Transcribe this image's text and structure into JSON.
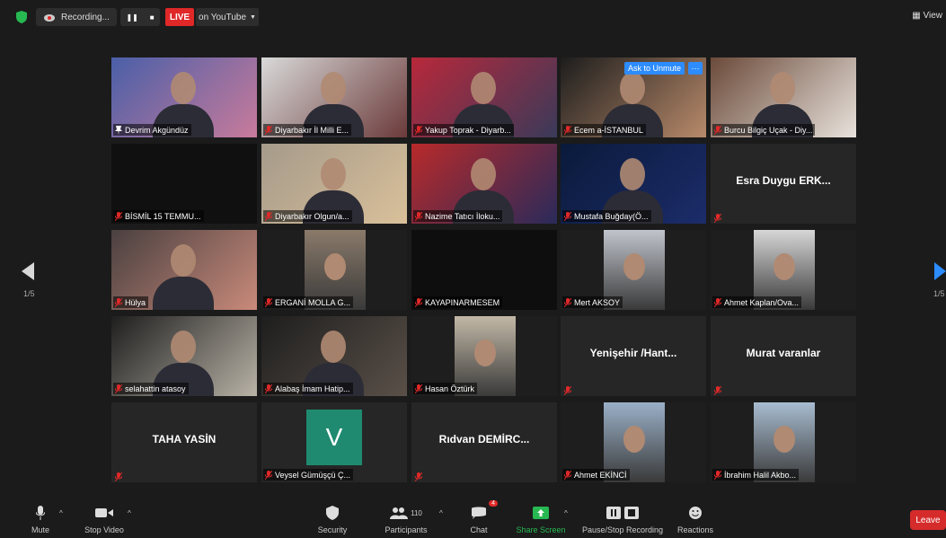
{
  "topbar": {
    "recording_label": "Recording...",
    "live_label": "LIVE",
    "stream_label": "on YouTube",
    "view_label": "View"
  },
  "unmute_label": "Ask to Unmute",
  "more_label": "···",
  "pagination": {
    "left": "1/5",
    "right": "1/5"
  },
  "tiles": [
    {
      "name": "Devrim Akgündüz",
      "type": "video",
      "colors": [
        "#4a5fa8",
        "#c97b9b"
      ]
    },
    {
      "name": "Diyarbakır İl Milli E...",
      "type": "video",
      "colors": [
        "#d9d9d9",
        "#6b3a3a"
      ]
    },
    {
      "name": "Yakup Toprak - Diyarb...",
      "type": "video",
      "colors": [
        "#b8283a",
        "#3a3a5a"
      ]
    },
    {
      "name": "Ecem a-İSTANBUL",
      "type": "video",
      "colors": [
        "#1d1d1d",
        "#b88a6a"
      ]
    },
    {
      "name": "Burcu Bilgiç Uçak - Diy...",
      "type": "video",
      "colors": [
        "#6b4a3a",
        "#e8e2dc"
      ]
    },
    {
      "name": "BİSMİL 15 TEMMU...",
      "type": "blank",
      "colors": [
        "#101010",
        "#101010"
      ]
    },
    {
      "name": "Diyarbakır Olgun/a...",
      "type": "video",
      "colors": [
        "#a59a8a",
        "#d9c09a"
      ]
    },
    {
      "name": "Nazime Tatıcı İloku...",
      "type": "video",
      "colors": [
        "#b82a2a",
        "#2a2a5a"
      ]
    },
    {
      "name": "Mustafa Buğday(Ö...",
      "type": "video",
      "colors": [
        "#0a1a3a",
        "#1c2c6a"
      ]
    },
    {
      "name": "Esra Duygu ERK...",
      "type": "name"
    },
    {
      "name": "Hülya",
      "type": "video",
      "colors": [
        "#4a4040",
        "#c98a7a"
      ]
    },
    {
      "name": "ERGANİ MOLLA G...",
      "type": "video",
      "colors": [
        "#1e1e1e",
        "#8a7a6a"
      ]
    },
    {
      "name": "KAYAPINARMESEM",
      "type": "blank",
      "colors": [
        "#0e0e0e",
        "#0e0e0e"
      ]
    },
    {
      "name": "Mert AKSOY",
      "type": "video",
      "colors": [
        "#1e1e1e",
        "#c0c4cc"
      ]
    },
    {
      "name": "Ahmet Kaplan/Ova...",
      "type": "video",
      "colors": [
        "#1e1e1e",
        "#d6d6d6"
      ]
    },
    {
      "name": "selahattin atasoy",
      "type": "video",
      "colors": [
        "#1e1e1e",
        "#b8b2a6"
      ]
    },
    {
      "name": "Alabaş İmam Hatip...",
      "type": "video",
      "colors": [
        "#1e1e1e",
        "#5a5048"
      ]
    },
    {
      "name": "Hasan Öztürk",
      "type": "video",
      "colors": [
        "#1e1e1e",
        "#c2b8a6"
      ]
    },
    {
      "name": "Yenişehir /Hant...",
      "type": "name"
    },
    {
      "name": "Murat varanlar",
      "type": "name"
    },
    {
      "name": "TAHA YASİN",
      "type": "name"
    },
    {
      "name": "Veysel Gümüşçü Ç...",
      "type": "avatar",
      "letter": "V",
      "avatar_color": "#1f8a70"
    },
    {
      "name": "Rıdvan DEMİRC...",
      "type": "name"
    },
    {
      "name": "Ahmet EKİNCİ",
      "type": "video",
      "colors": [
        "#1e1e1e",
        "#9ab0c8"
      ]
    },
    {
      "name": "İbrahim Halil Akbo...",
      "type": "video",
      "colors": [
        "#1e1e1e",
        "#a8bcd0"
      ]
    }
  ],
  "toolbar": {
    "mute": "Mute",
    "stop_video": "Stop Video",
    "security": "Security",
    "participants": "Participants",
    "participants_count": "110",
    "chat": "Chat",
    "chat_badge": "4",
    "share_screen": "Share Screen",
    "pause_recording": "Pause/Stop Recording",
    "reactions": "Reactions",
    "leave": "Leave"
  },
  "colors": {
    "accent_green": "#27b852",
    "live_red": "#e02828",
    "unmute_blue": "#2d8cff",
    "active_outline": "#c8d83a"
  }
}
